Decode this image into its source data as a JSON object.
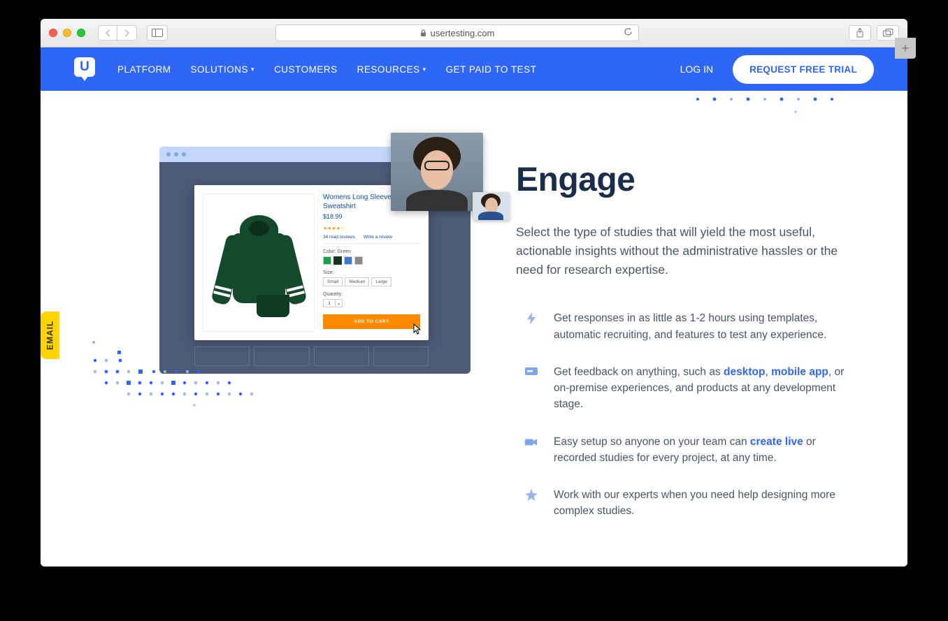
{
  "browser": {
    "domain": "usertesting.com",
    "new_tab": "+"
  },
  "header": {
    "nav": {
      "platform": "PLATFORM",
      "solutions": "SOLUTIONS",
      "customers": "CUSTOMERS",
      "resources": "RESOURCES",
      "get_paid": "GET PAID TO TEST"
    },
    "login": "LOG IN",
    "cta": "REQUEST FREE TRIAL",
    "logo_letter": "U"
  },
  "email_tab": "EMAIL",
  "mock_product": {
    "title": "Womens Long Sleeve Hoodie Sweatshirt",
    "price": "$18.99",
    "reviews_read": "34 read reviews",
    "write_review": "Write a review",
    "color_label": "Color: Green",
    "size_label": "Size:",
    "sizes": {
      "s": "Small",
      "m": "Medium",
      "l": "Large"
    },
    "qty_label": "Quantity:",
    "qty_value": "1",
    "add_cart": "ADD TO CART"
  },
  "content": {
    "heading": "Engage",
    "lead": "Select the type of studies that will yield the most useful, actionable insights without the administrative hassles or the need for research expertise.",
    "features": {
      "f1": "Get responses in as little as 1-2 hours using templates, automatic recruiting, and features to test any experience.",
      "f2_pre": "Get feedback on anything, such as ",
      "f2_link1": "desktop",
      "f2_mid": ", ",
      "f2_link2": "mobile app",
      "f2_post": ", or on-premise experiences, and products at any development stage.",
      "f3_pre": "Easy setup so anyone on your team can ",
      "f3_link": "create live",
      "f3_post": " or recorded studies for every project, at any time.",
      "f4": "Work with our experts when you need help designing more complex studies."
    }
  }
}
